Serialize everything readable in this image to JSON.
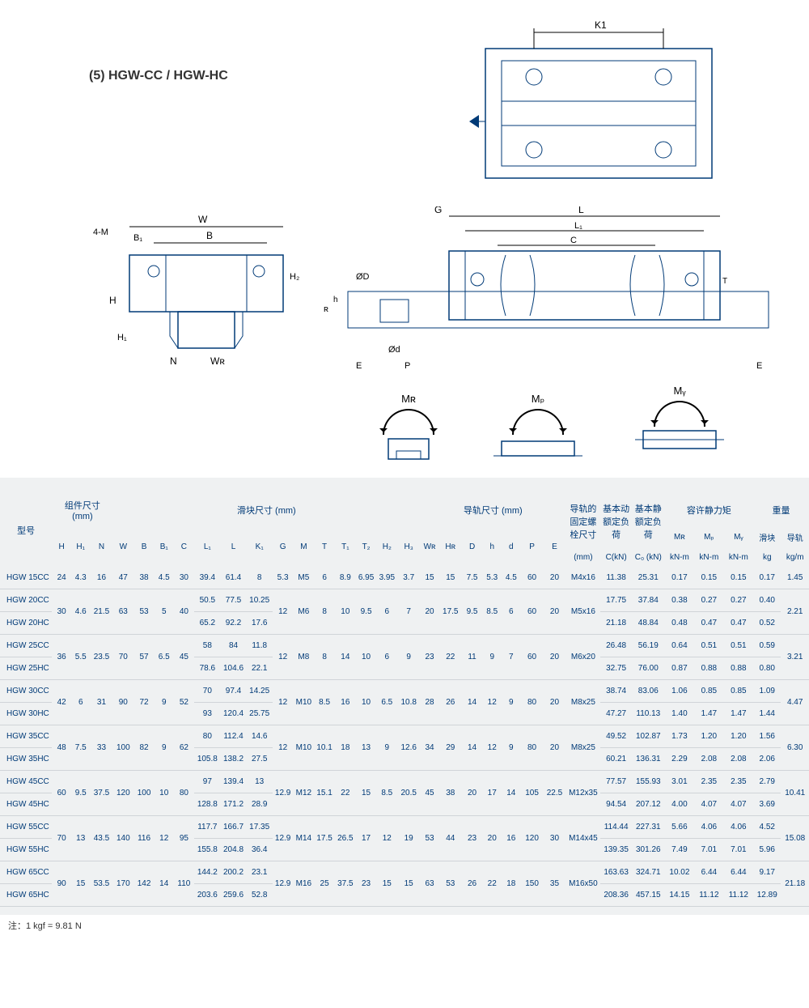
{
  "title": "(5) HGW-CC / HGW-HC",
  "drawing_labels": {
    "K1": "K1",
    "W": "W",
    "B": "B",
    "B1": "B₁",
    "H": "H",
    "H1": "H₁",
    "H2": "H₂",
    "N": "N",
    "WR": "Wʀ",
    "M4": "4-M",
    "G": "G",
    "L": "L",
    "L1": "L₁",
    "C": "C",
    "T": "T",
    "HR": "Hʀ",
    "h": "h",
    "OD": "ØD",
    "Od": "Ød",
    "E": "E",
    "P": "P"
  },
  "moments": {
    "MR": "Mʀ",
    "MP": "Mₚ",
    "MY": "Mᵧ"
  },
  "headers": {
    "model": "型号",
    "assembly": "组件尺寸 (mm)",
    "block": "滑块尺寸 (mm)",
    "rail": "导轨尺寸 (mm)",
    "bolt": "导轨的固定螺栓尺寸",
    "dyn": "基本动额定负荷",
    "stat": "基本静额定负荷",
    "moment": "容许静力矩",
    "weight": "重量",
    "cols": {
      "H": "H",
      "H1": "H₁",
      "N": "N",
      "W": "W",
      "B": "B",
      "B1": "B₁",
      "C": "C",
      "L1": "L₁",
      "L": "L",
      "K1": "K₁",
      "G": "G",
      "M": "M",
      "T": "T",
      "T1": "T₁",
      "T2": "T₂",
      "H2": "H₂",
      "H3": "H₃",
      "WR": "Wʀ",
      "HR": "Hʀ",
      "D": "D",
      "h": "h",
      "d": "d",
      "P": "P",
      "E": "E",
      "bolt": "(mm)",
      "C_kN": "C(kN)",
      "C0_kN": "C₀ (kN)",
      "MR": "Mʀ",
      "MP": "Mₚ",
      "MY": "Mᵧ",
      "block_wt": "滑块",
      "rail_wt": "导轨",
      "kNm": "kN-m",
      "kg": "kg",
      "kgm": "kg/m"
    }
  },
  "rows": [
    {
      "model": "HGW 15CC",
      "H": "24",
      "H1": "4.3",
      "N": "16",
      "W": "47",
      "B": "38",
      "B1": "4.5",
      "C": "30",
      "L1": "39.4",
      "L": "61.4",
      "K1": "8",
      "G": "5.3",
      "M": "M5",
      "T": "6",
      "T1": "8.9",
      "T2": "6.95",
      "H2": "3.95",
      "H3": "3.7",
      "WR": "15",
      "HR": "15",
      "D": "7.5",
      "h": "5.3",
      "d": "4.5",
      "P": "60",
      "E": "20",
      "bolt": "M4x16",
      "CkN": "11.38",
      "C0kN": "25.31",
      "MR": "0.17",
      "MP": "0.15",
      "MY": "0.15",
      "bw": "0.17",
      "rw": "1.45"
    },
    {
      "model": "HGW 20CC",
      "H": "30",
      "H1": "4.6",
      "N": "21.5",
      "W": "63",
      "B": "53",
      "B1": "5",
      "C": "40",
      "L1": "50.5",
      "L": "77.5",
      "K1": "10.25",
      "G": "12",
      "M": "M6",
      "T": "8",
      "T1": "10",
      "T2": "9.5",
      "H2": "6",
      "H3": "7",
      "WR": "20",
      "HR": "17.5",
      "D": "9.5",
      "h": "8.5",
      "d": "6",
      "P": "60",
      "E": "20",
      "bolt": "M5x16",
      "CkN": "17.75",
      "C0kN": "37.84",
      "MR": "0.38",
      "MP": "0.27",
      "MY": "0.27",
      "bw": "0.40",
      "rw": "2.21",
      "rowspan_group": "g20"
    },
    {
      "model": "HGW 20HC",
      "L1": "65.2",
      "L": "92.2",
      "K1": "17.6",
      "CkN": "21.18",
      "C0kN": "48.84",
      "MR": "0.48",
      "MP": "0.47",
      "MY": "0.47",
      "bw": "0.52",
      "rowspan_group": "g20"
    },
    {
      "model": "HGW 25CC",
      "H": "36",
      "H1": "5.5",
      "N": "23.5",
      "W": "70",
      "B": "57",
      "B1": "6.5",
      "C": "45",
      "L1": "58",
      "L": "84",
      "K1": "11.8",
      "G": "12",
      "M": "M8",
      "T": "8",
      "T1": "14",
      "T2": "10",
      "H2": "6",
      "H3": "9",
      "WR": "23",
      "HR": "22",
      "D": "11",
      "h": "9",
      "d": "7",
      "P": "60",
      "E": "20",
      "bolt": "M6x20",
      "CkN": "26.48",
      "C0kN": "56.19",
      "MR": "0.64",
      "MP": "0.51",
      "MY": "0.51",
      "bw": "0.59",
      "rw": "3.21",
      "rowspan_group": "g25"
    },
    {
      "model": "HGW 25HC",
      "L1": "78.6",
      "L": "104.6",
      "K1": "22.1",
      "CkN": "32.75",
      "C0kN": "76.00",
      "MR": "0.87",
      "MP": "0.88",
      "MY": "0.88",
      "bw": "0.80",
      "rowspan_group": "g25"
    },
    {
      "model": "HGW 30CC",
      "H": "42",
      "H1": "6",
      "N": "31",
      "W": "90",
      "B": "72",
      "B1": "9",
      "C": "52",
      "L1": "70",
      "L": "97.4",
      "K1": "14.25",
      "G": "12",
      "M": "M10",
      "T": "8.5",
      "T1": "16",
      "T2": "10",
      "H2": "6.5",
      "H3": "10.8",
      "WR": "28",
      "HR": "26",
      "D": "14",
      "h": "12",
      "d": "9",
      "P": "80",
      "E": "20",
      "bolt": "M8x25",
      "CkN": "38.74",
      "C0kN": "83.06",
      "MR": "1.06",
      "MP": "0.85",
      "MY": "0.85",
      "bw": "1.09",
      "rw": "4.47",
      "rowspan_group": "g30"
    },
    {
      "model": "HGW 30HC",
      "L1": "93",
      "L": "120.4",
      "K1": "25.75",
      "CkN": "47.27",
      "C0kN": "110.13",
      "MR": "1.40",
      "MP": "1.47",
      "MY": "1.47",
      "bw": "1.44",
      "rowspan_group": "g30"
    },
    {
      "model": "HGW 35CC",
      "H": "48",
      "H1": "7.5",
      "N": "33",
      "W": "100",
      "B": "82",
      "B1": "9",
      "C": "62",
      "L1": "80",
      "L": "112.4",
      "K1": "14.6",
      "G": "12",
      "M": "M10",
      "T": "10.1",
      "T1": "18",
      "T2": "13",
      "H2": "9",
      "H3": "12.6",
      "WR": "34",
      "HR": "29",
      "D": "14",
      "h": "12",
      "d": "9",
      "P": "80",
      "E": "20",
      "bolt": "M8x25",
      "CkN": "49.52",
      "C0kN": "102.87",
      "MR": "1.73",
      "MP": "1.20",
      "MY": "1.20",
      "bw": "1.56",
      "rw": "6.30",
      "rowspan_group": "g35"
    },
    {
      "model": "HGW 35HC",
      "L1": "105.8",
      "L": "138.2",
      "K1": "27.5",
      "CkN": "60.21",
      "C0kN": "136.31",
      "MR": "2.29",
      "MP": "2.08",
      "MY": "2.08",
      "bw": "2.06",
      "rowspan_group": "g35"
    },
    {
      "model": "HGW 45CC",
      "H": "60",
      "H1": "9.5",
      "N": "37.5",
      "W": "120",
      "B": "100",
      "B1": "10",
      "C": "80",
      "L1": "97",
      "L": "139.4",
      "K1": "13",
      "G": "12.9",
      "M": "M12",
      "T": "15.1",
      "T1": "22",
      "T2": "15",
      "H2": "8.5",
      "H3": "20.5",
      "WR": "45",
      "HR": "38",
      "D": "20",
      "h": "17",
      "d": "14",
      "P": "105",
      "E": "22.5",
      "bolt": "M12x35",
      "CkN": "77.57",
      "C0kN": "155.93",
      "MR": "3.01",
      "MP": "2.35",
      "MY": "2.35",
      "bw": "2.79",
      "rw": "10.41",
      "rowspan_group": "g45"
    },
    {
      "model": "HGW 45HC",
      "L1": "128.8",
      "L": "171.2",
      "K1": "28.9",
      "CkN": "94.54",
      "C0kN": "207.12",
      "MR": "4.00",
      "MP": "4.07",
      "MY": "4.07",
      "bw": "3.69",
      "rowspan_group": "g45"
    },
    {
      "model": "HGW 55CC",
      "H": "70",
      "H1": "13",
      "N": "43.5",
      "W": "140",
      "B": "116",
      "B1": "12",
      "C": "95",
      "L1": "117.7",
      "L": "166.7",
      "K1": "17.35",
      "G": "12.9",
      "M": "M14",
      "T": "17.5",
      "T1": "26.5",
      "T2": "17",
      "H2": "12",
      "H3": "19",
      "WR": "53",
      "HR": "44",
      "D": "23",
      "h": "20",
      "d": "16",
      "P": "120",
      "E": "30",
      "bolt": "M14x45",
      "CkN": "114.44",
      "C0kN": "227.31",
      "MR": "5.66",
      "MP": "4.06",
      "MY": "4.06",
      "bw": "4.52",
      "rw": "15.08",
      "rowspan_group": "g55"
    },
    {
      "model": "HGW 55HC",
      "L1": "155.8",
      "L": "204.8",
      "K1": "36.4",
      "CkN": "139.35",
      "C0kN": "301.26",
      "MR": "7.49",
      "MP": "7.01",
      "MY": "7.01",
      "bw": "5.96",
      "rowspan_group": "g55"
    },
    {
      "model": "HGW 65CC",
      "H": "90",
      "H1": "15",
      "N": "53.5",
      "W": "170",
      "B": "142",
      "B1": "14",
      "C": "110",
      "L1": "144.2",
      "L": "200.2",
      "K1": "23.1",
      "G": "12.9",
      "M": "M16",
      "T": "25",
      "T1": "37.5",
      "T2": "23",
      "H2": "15",
      "H3": "15",
      "WR": "63",
      "HR": "53",
      "D": "26",
      "h": "22",
      "d": "18",
      "P": "150",
      "E": "35",
      "bolt": "M16x50",
      "CkN": "163.63",
      "C0kN": "324.71",
      "MR": "10.02",
      "MP": "6.44",
      "MY": "6.44",
      "bw": "9.17",
      "rw": "21.18",
      "rowspan_group": "g65"
    },
    {
      "model": "HGW 65HC",
      "L1": "203.6",
      "L": "259.6",
      "K1": "52.8",
      "CkN": "208.36",
      "C0kN": "457.15",
      "MR": "14.15",
      "MP": "11.12",
      "MY": "11.12",
      "bw": "12.89",
      "rowspan_group": "g65"
    }
  ],
  "note": "注：1 kgf = 9.81 N"
}
